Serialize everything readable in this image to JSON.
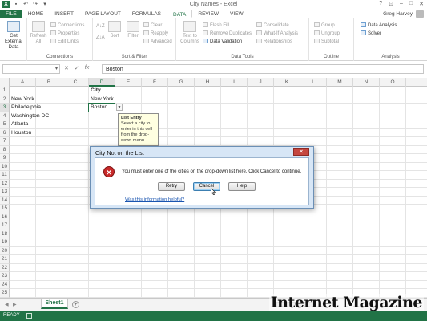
{
  "window": {
    "title": "City Names - Excel",
    "user": "Greg Harvey",
    "controls": [
      "?",
      "⊡",
      "–",
      "□",
      "✕"
    ]
  },
  "tabs": [
    "FILE",
    "HOME",
    "INSERT",
    "PAGE LAYOUT",
    "FORMULAS",
    "DATA",
    "REVIEW",
    "VIEW"
  ],
  "active_tab": "DATA",
  "ribbon": {
    "get_external": "Get External Data",
    "refresh": "Refresh All",
    "connections_items": [
      "Connections",
      "Properties",
      "Edit Links"
    ],
    "connections_label": "Connections",
    "sort_label": "Sort",
    "filter_label": "Filter",
    "filter_items": [
      "Clear",
      "Reapply",
      "Advanced"
    ],
    "sort_filter_label": "Sort & Filter",
    "text_to_columns": "Text to Columns",
    "data_tools_items_1": [
      "Flash Fill",
      "Remove Duplicates",
      "Data Validation"
    ],
    "data_tools_items_2": [
      "Consolidate",
      "What-If Analysis",
      "Relationships"
    ],
    "data_tools_label": "Data Tools",
    "outline_items": [
      "Group",
      "Ungroup",
      "Subtotal"
    ],
    "outline_label": "Outline",
    "analysis_items": [
      "Data Analysis",
      "Solver"
    ],
    "analysis_label": "Analysis"
  },
  "formula_bar": {
    "name_box": "",
    "fx": "fx",
    "value": "Boston"
  },
  "columns": [
    "A",
    "B",
    "C",
    "D",
    "E",
    "F",
    "G",
    "H",
    "I",
    "J",
    "K",
    "L",
    "M",
    "N",
    "O"
  ],
  "rows": [
    "1",
    "2",
    "3",
    "4",
    "5",
    "6",
    "7",
    "8",
    "9",
    "10",
    "11",
    "12",
    "13",
    "14",
    "15",
    "16",
    "17",
    "18",
    "19",
    "20",
    "21",
    "22",
    "23",
    "24",
    "25"
  ],
  "cells": {
    "a2": "New York",
    "a3": "Philadelphia",
    "a4": "Washington DC",
    "a5": "Atlanta",
    "a6": "Houston",
    "d1": "City",
    "d2": "New York",
    "d3": "Boston"
  },
  "input_message": {
    "title": "List Entry",
    "body": "Select a city to enter in this cell from the drop-down menu"
  },
  "dialog": {
    "title": "City Not on the List",
    "message": "You must enter one of the cities on the drop-down list here. Click Cancel to continue.",
    "buttons": [
      "Retry",
      "Cancel",
      "Help"
    ],
    "help_link": "Was this information helpful?"
  },
  "sheet_tabs": [
    "Sheet1"
  ],
  "status": "READY",
  "watermark": "Internet Magazine"
}
